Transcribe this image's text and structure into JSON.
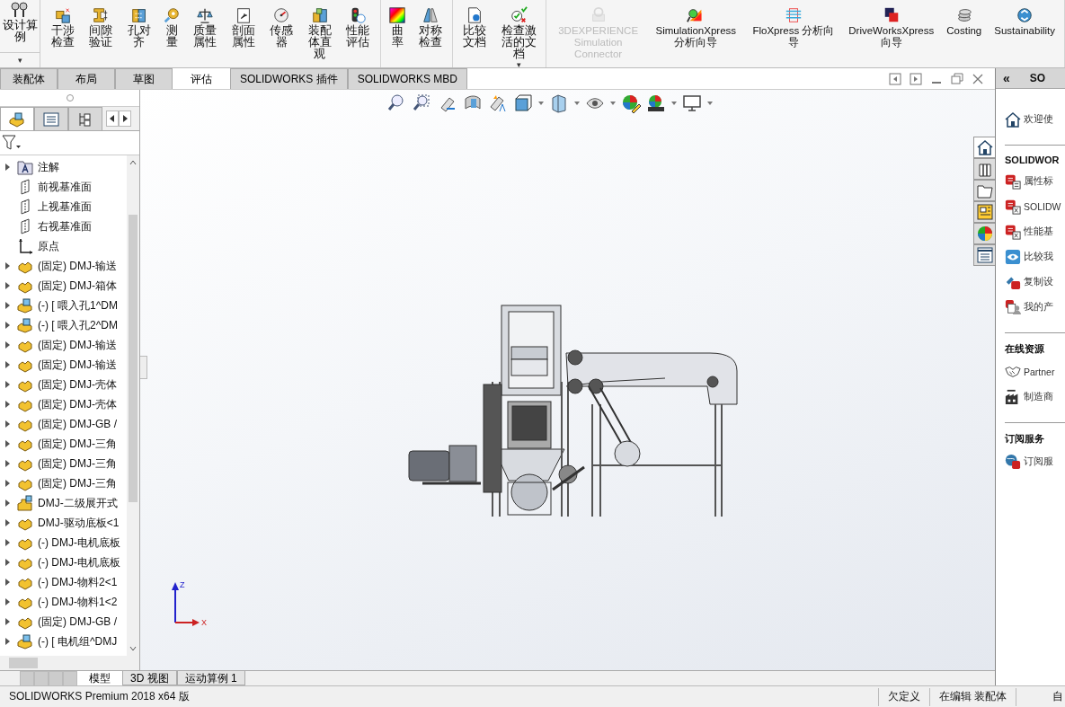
{
  "command_manager": {
    "design_study": {
      "label": "设计算例",
      "dropdown": "▾"
    },
    "groups": [
      {
        "items": [
          {
            "label": "干涉检查",
            "disabled": false
          },
          {
            "label": "间隙验证",
            "disabled": false
          },
          {
            "label": "孔对齐",
            "disabled": false
          },
          {
            "label": "测量",
            "disabled": false
          },
          {
            "label": "质量属性",
            "disabled": false
          },
          {
            "label": "剖面属性",
            "disabled": false
          },
          {
            "label": "传感器",
            "disabled": false
          },
          {
            "label": "装配体直观",
            "disabled": false
          },
          {
            "label": "性能评估",
            "disabled": false
          }
        ]
      },
      {
        "items": [
          {
            "label": "曲率",
            "disabled": false
          },
          {
            "label": "对称检查",
            "disabled": false
          }
        ]
      },
      {
        "items": [
          {
            "label": "比较文档",
            "disabled": false
          },
          {
            "label": "检查激活的文档",
            "disabled": false,
            "dropdown": "▾"
          }
        ]
      },
      {
        "items": [
          {
            "label": "3DEXPERIENCE Simulation Connector",
            "disabled": true
          },
          {
            "label": "SimulationXpress 分析向导",
            "disabled": false
          },
          {
            "label": "FloXpress 分析向导",
            "disabled": false
          },
          {
            "label": "DriveWorksXpress 向导",
            "disabled": false
          },
          {
            "label": "Costing",
            "disabled": false
          },
          {
            "label": "Sustainability",
            "disabled": false
          }
        ]
      }
    ]
  },
  "tabs": [
    {
      "label": "装配体",
      "selected": false
    },
    {
      "label": "布局",
      "selected": false
    },
    {
      "label": "草图",
      "selected": false
    },
    {
      "label": "评估",
      "selected": true
    },
    {
      "label": "SOLIDWORKS 插件",
      "selected": false
    },
    {
      "label": "SOLIDWORKS MBD",
      "selected": false
    }
  ],
  "feature_tree": {
    "items": [
      {
        "kind": "annotations",
        "label": "注解",
        "expanded": false
      },
      {
        "kind": "plane",
        "label": "前视基准面"
      },
      {
        "kind": "plane",
        "label": "上视基准面"
      },
      {
        "kind": "plane",
        "label": "右视基准面"
      },
      {
        "kind": "origin",
        "label": "原点"
      },
      {
        "kind": "part",
        "label": "(固定) DMJ-输送",
        "expanded": false
      },
      {
        "kind": "part",
        "label": "(固定) DMJ-箱体",
        "expanded": false
      },
      {
        "kind": "subassembly",
        "label": "(-) [ 喂入孔1^DM",
        "expanded": false
      },
      {
        "kind": "subassembly",
        "label": "(-) [ 喂入孔2^DM",
        "expanded": false
      },
      {
        "kind": "part",
        "label": "(固定) DMJ-输送",
        "expanded": false
      },
      {
        "kind": "part",
        "label": "(固定) DMJ-输送",
        "expanded": false
      },
      {
        "kind": "part",
        "label": "(固定) DMJ-壳体",
        "expanded": false
      },
      {
        "kind": "part",
        "label": "(固定) DMJ-壳体",
        "expanded": false
      },
      {
        "kind": "part",
        "label": "(固定) DMJ-GB /",
        "expanded": false
      },
      {
        "kind": "part",
        "label": "(固定) DMJ-三角",
        "expanded": false
      },
      {
        "kind": "part",
        "label": "(固定) DMJ-三角",
        "expanded": false
      },
      {
        "kind": "part",
        "label": "(固定) DMJ-三角",
        "expanded": false
      },
      {
        "kind": "flexible",
        "label": "DMJ-二级展开式",
        "expanded": false
      },
      {
        "kind": "part",
        "label": "DMJ-驱动底板<1",
        "expanded": false
      },
      {
        "kind": "part",
        "label": "(-) DMJ-电机底板",
        "expanded": false
      },
      {
        "kind": "part",
        "label": "(-) DMJ-电机底板",
        "expanded": false
      },
      {
        "kind": "part",
        "label": "(-) DMJ-物料2<1",
        "expanded": false
      },
      {
        "kind": "part",
        "label": "(-) DMJ-物料1<2",
        "expanded": false
      },
      {
        "kind": "part",
        "label": "(固定) DMJ-GB /",
        "expanded": false
      },
      {
        "kind": "subassembly",
        "label": "(-) [ 电机组^DMJ",
        "expanded": false
      }
    ]
  },
  "panel_tabs": [
    {
      "kind": "feature-manager",
      "selected": true
    },
    {
      "kind": "property-manager",
      "selected": false
    },
    {
      "kind": "configuration-manager",
      "selected": false
    }
  ],
  "viewport": {
    "triad": {
      "z": "Z",
      "x": "X"
    }
  },
  "task_pane": {
    "header": "SO",
    "collapse": "«",
    "tabs": [
      {
        "kind": "home",
        "selected": true
      },
      {
        "kind": "library",
        "selected": false
      },
      {
        "kind": "explorer",
        "selected": false
      },
      {
        "kind": "palette",
        "selected": false
      },
      {
        "kind": "appearance",
        "selected": false
      },
      {
        "kind": "properties",
        "selected": false
      }
    ],
    "welcome": "欢迎使",
    "sections": [
      {
        "title": "SOLIDWOR",
        "items": [
          {
            "kind": "sw-form",
            "label": "属性标"
          },
          {
            "kind": "sw-rx",
            "label": "SOLIDW"
          },
          {
            "kind": "sw-rx",
            "label": "性能基"
          },
          {
            "kind": "compare",
            "label": "比较我"
          },
          {
            "kind": "sw-copy",
            "label": "复制设"
          },
          {
            "kind": "sw-product",
            "label": "我的产"
          }
        ]
      },
      {
        "title": "在线资源",
        "items": [
          {
            "kind": "handshake",
            "label": "Partner"
          },
          {
            "kind": "factory",
            "label": "制造商"
          }
        ]
      },
      {
        "title": "订阅服务",
        "items": [
          {
            "kind": "sw-globe",
            "label": "订阅服"
          }
        ]
      }
    ]
  },
  "bottom_tabs": [
    {
      "label": "模型",
      "selected": true
    },
    {
      "label": "3D 视图",
      "selected": false
    },
    {
      "label": "运动算例 1",
      "selected": false
    }
  ],
  "status_bar": {
    "product": "SOLIDWORKS Premium 2018 x64 版",
    "definition": "欠定义",
    "mode": "在编辑 装配体",
    "units": "自"
  }
}
